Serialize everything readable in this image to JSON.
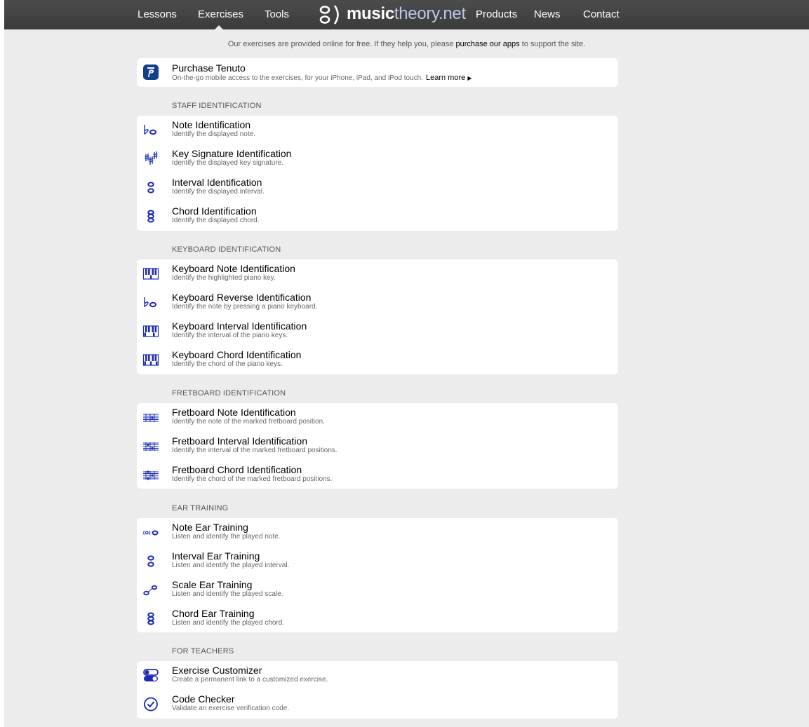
{
  "nav": {
    "lessons": "Lessons",
    "exercises": "Exercises",
    "tools": "Tools",
    "logo_bold": "music",
    "logo_light": "theory.net",
    "products": "Products",
    "news": "News",
    "contact": "Contact"
  },
  "notice": {
    "prefix": "Our exercises are provided online for free. If they help you, please",
    "link": "purchase our apps",
    "suffix": "to support the site."
  },
  "promo": {
    "title": "Purchase Tenuto",
    "subtitle": "On-the-go mobile access to the exercises, for your iPhone, iPad, and iPod touch.",
    "more": "Learn more"
  },
  "sections": [
    {
      "heading": "STAFF IDENTIFICATION",
      "items": [
        {
          "icon": "flat-note-icon",
          "title": "Note Identification",
          "subtitle": "Identify the displayed note."
        },
        {
          "icon": "key-signature-icon",
          "title": "Key Signature Identification",
          "subtitle": "Identify the displayed key signature."
        },
        {
          "icon": "interval-icon",
          "title": "Interval Identification",
          "subtitle": "Identify the displayed interval."
        },
        {
          "icon": "chord-icon",
          "title": "Chord Identification",
          "subtitle": "Identify the displayed chord."
        }
      ]
    },
    {
      "heading": "KEYBOARD IDENTIFICATION",
      "items": [
        {
          "icon": "keyboard-icon",
          "title": "Keyboard Note Identification",
          "subtitle": "Identify the highlighted piano key."
        },
        {
          "icon": "flat-note-icon",
          "title": "Keyboard Reverse Identification",
          "subtitle": "Identify the note by pressing a piano keyboard."
        },
        {
          "icon": "keyboard-icon",
          "title": "Keyboard Interval Identification",
          "subtitle": "Identify the interval of the piano keys."
        },
        {
          "icon": "keyboard-icon",
          "title": "Keyboard Chord Identification",
          "subtitle": "Identify the chord of the piano keys."
        }
      ]
    },
    {
      "heading": "FRETBOARD IDENTIFICATION",
      "items": [
        {
          "icon": "fretboard-icon",
          "title": "Fretboard Note Identification",
          "subtitle": "Identify the note of the marked fretboard position."
        },
        {
          "icon": "fretboard-icon",
          "title": "Fretboard Interval Identification",
          "subtitle": "Identify the interval of the marked fretboard positions."
        },
        {
          "icon": "fretboard-icon",
          "title": "Fretboard Chord Identification",
          "subtitle": "Identify the chord of the marked fretboard positions."
        }
      ]
    },
    {
      "heading": "EAR TRAINING",
      "items": [
        {
          "icon": "ear-note-icon",
          "title": "Note Ear Training",
          "subtitle": "Listen and identify the played note."
        },
        {
          "icon": "interval-icon",
          "title": "Interval Ear Training",
          "subtitle": "Listen and identify the played interval."
        },
        {
          "icon": "scale-icon",
          "title": "Scale Ear Training",
          "subtitle": "Listen and identify the played scale."
        },
        {
          "icon": "chord-icon",
          "title": "Chord Ear Training",
          "subtitle": "Listen and identify the played chord."
        }
      ]
    },
    {
      "heading": "FOR TEACHERS",
      "items": [
        {
          "icon": "toggle-icon",
          "title": "Exercise Customizer",
          "subtitle": "Create a permanent link to a customized exercise."
        },
        {
          "icon": "checkmark-icon",
          "title": "Code Checker",
          "subtitle": "Validate an exercise verification code."
        }
      ]
    }
  ],
  "colors": {
    "topbar": "#3f3f3f",
    "page_bg": "#ececec",
    "card_bg": "#ffffff",
    "icon_blue": "#1a2bb8",
    "tenuto_blue": "#123f8a"
  }
}
